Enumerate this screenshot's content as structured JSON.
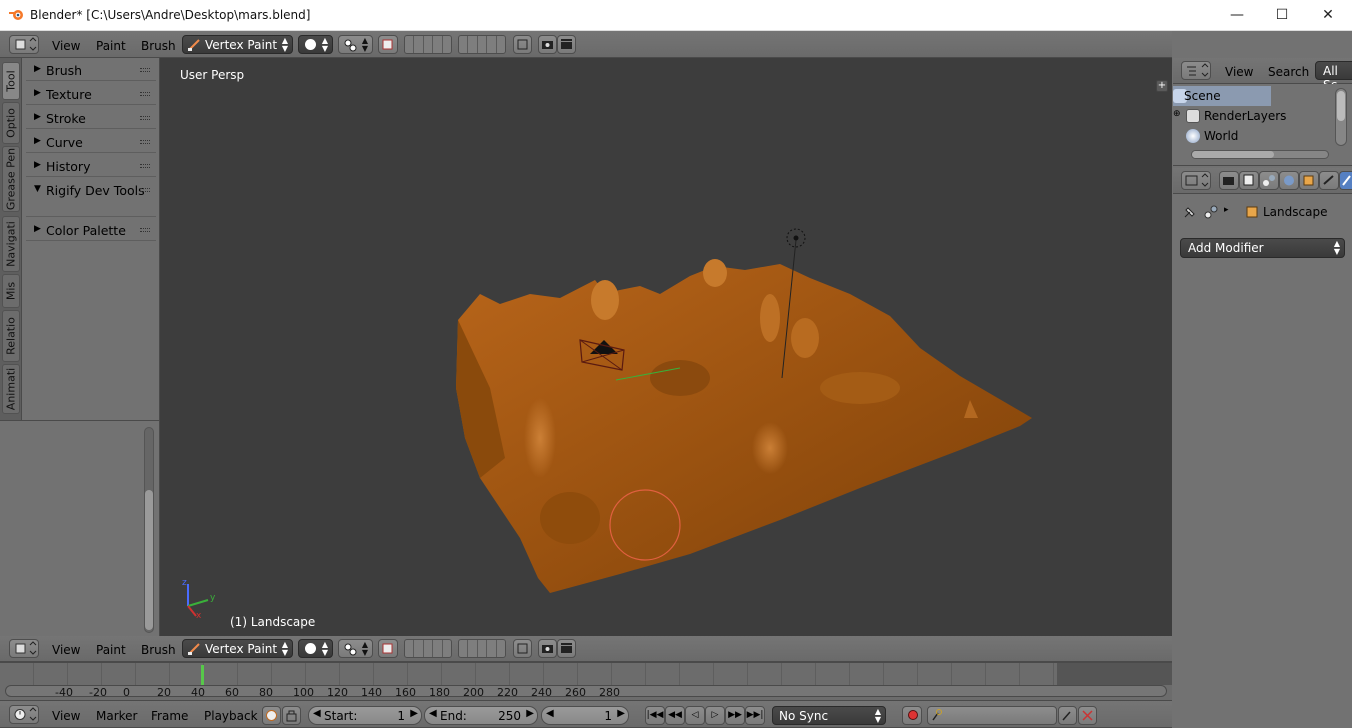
{
  "window": {
    "title": "Blender* [C:\\Users\\Andre\\Desktop\\mars.blend]",
    "controls": {
      "minimize": "—",
      "maximize": "☐",
      "close": "✕"
    }
  },
  "top_header": {
    "menus": [
      "View",
      "Paint",
      "Brush"
    ],
    "mode_label": "Vertex Paint"
  },
  "left_tabs": [
    "Tool",
    "Optio",
    "Grease Pen",
    "Navigati",
    "Mis",
    "Relatio",
    "Animati"
  ],
  "tool_panels": [
    "Brush",
    "Texture",
    "Stroke",
    "Curve",
    "History",
    "Rigify Dev Tools",
    "Color Palette"
  ],
  "viewport": {
    "view_label": "User Persp",
    "object_label": "(1) Landscape",
    "axis": {
      "x": "x",
      "y": "y",
      "z": "z"
    }
  },
  "bottom_header": {
    "menus": [
      "View",
      "Paint",
      "Brush"
    ],
    "mode_label": "Vertex Paint"
  },
  "timeline": {
    "ticks": [
      "-40",
      "-20",
      "0",
      "20",
      "40",
      "60",
      "80",
      "100",
      "120",
      "140",
      "160",
      "180",
      "200",
      "220",
      "240",
      "260",
      "280"
    ],
    "menus": [
      "View",
      "Marker",
      "Frame",
      "Playback"
    ],
    "start_label": "Start:",
    "start_value": "1",
    "end_label": "End:",
    "end_value": "250",
    "current_frame": "1",
    "sync_label": "No Sync"
  },
  "outliner": {
    "menus": [
      "View",
      "Search"
    ],
    "filter_label": "All Sc",
    "items": [
      "Scene",
      "RenderLayers",
      "World"
    ]
  },
  "properties": {
    "object_name": "Landscape",
    "add_modifier_label": "Add Modifier"
  },
  "colors": {
    "header_bg": "#727272",
    "viewport_bg": "#3d3d3d",
    "terrain": "#a8590e",
    "selection": "#4a4a4a"
  }
}
